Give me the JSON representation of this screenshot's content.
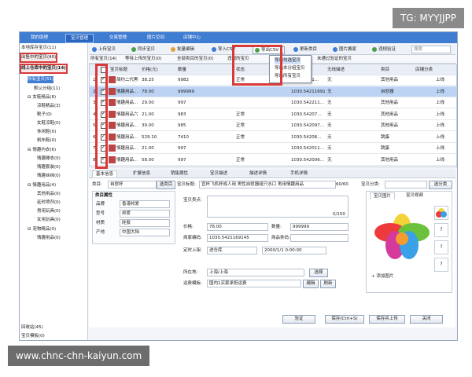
{
  "watermark": "TG: MYYJJPP",
  "footer_url": "www.chnc-chn-kaiyun.com",
  "colors": {
    "accent": "#3f7dd3",
    "highlight": "#d83a3a",
    "selected_row": "#bcd3f4"
  },
  "topnav": [
    "我的助理",
    "宝贝管理",
    "交易管理",
    "图片空间",
    "店铺中心"
  ],
  "sidebar": {
    "items": [
      "本地库存宝贝(11)",
      "出售中的宝贝(40)",
      "线上仓库中的宝贝(14)",
      "所有宝贝(51)",
      "默认分组(11)",
      "女鞋精品(8)",
      "凉鞋精品(3)",
      "靴子(0)",
      "女鞋凉鞋(0)",
      "休闲鞋(0)",
      "帆布鞋(0)",
      "情趣内衣(6)",
      "情趣睡衣(0)",
      "情趣套装(0)",
      "情趣丝袜(0)",
      "情趣用品(4)",
      "其他用品(0)",
      "延时喷剂(0)",
      "男用玩具(0)",
      "女用玩具(0)",
      "宠物精品(0)",
      "情趣用品(0)",
      "回收站(45)",
      "宝贝模板(0)"
    ]
  },
  "toolbar": {
    "items": [
      "上传宝贝",
      "同步宝贝",
      "批量编辑",
      "导入CSV",
      "导出CSV",
      "更新类目",
      "图片搬家",
      "违规验证"
    ],
    "search_placeholder": "搜索"
  },
  "export_menu": [
    "导出勾选宝贝",
    "导出本分组宝贝",
    "导出所有宝贝"
  ],
  "filters": [
    "所有宝贝(14)",
    "等待上传的宝贝(0)",
    "全部类目的宝贝(0)",
    "违规的宝贝",
    "未通过验证的宝贝"
  ],
  "grid": {
    "headers": [
      "宝贝标题",
      "价格(元)",
      "数量",
      "状态",
      "商家编码",
      "无线描述",
      "类目",
      "店铺分类"
    ],
    "rows": [
      {
        "num": "1",
        "title": "简约二代黑...",
        "price": "38.25",
        "qty": "9982",
        "status": "正常",
        "code": "1030.5421...",
        "mobile": "无",
        "category": "其他用品",
        "shop": "上线"
      },
      {
        "num": "2",
        "title": "情趣用品...",
        "price": "78.00",
        "qty": "999999",
        "status": "",
        "code": "1030.54211691...",
        "mobile": "无",
        "category": "自慰器",
        "shop": "上线"
      },
      {
        "num": "3",
        "title": "情趣用品...",
        "price": "29.00",
        "qty": "997",
        "status": "",
        "code": "1030.542211...",
        "mobile": "无",
        "category": "其他用品",
        "shop": "上线"
      },
      {
        "num": "4",
        "title": "情趣用品六...",
        "price": "21.00",
        "qty": "983",
        "status": "正常",
        "code": "1030.54207...",
        "mobile": "无",
        "category": "其他用品",
        "shop": "上线"
      },
      {
        "num": "5",
        "title": "情趣用品...",
        "price": "39.00",
        "qty": "985",
        "status": "正常",
        "code": "1030.542097...",
        "mobile": "无",
        "category": "其他用品",
        "shop": "上线"
      },
      {
        "num": "6",
        "title": "情趣用品...",
        "price": "529.10",
        "qty": "7410",
        "status": "正常",
        "code": "1030.54206...",
        "mobile": "无",
        "category": "跳蛋",
        "shop": "上线"
      },
      {
        "num": "7",
        "title": "情趣用品...",
        "price": "21.00",
        "qty": "997",
        "status": "",
        "code": "1030.542011...",
        "mobile": "无",
        "category": "跳蛋",
        "shop": "上线"
      },
      {
        "num": "8",
        "title": "情趣用品...",
        "price": "58.00",
        "qty": "997",
        "status": "正常",
        "code": "1030.542006...",
        "mobile": "无",
        "category": "其他用品",
        "shop": "上线"
      }
    ]
  },
  "detail_tabs": [
    "基本信息",
    "扩展信息",
    "销售属性",
    "宝贝描述",
    "描述详情",
    "手机详情"
  ],
  "form": {
    "category_label": "类目:",
    "category_value": "自慰杯",
    "choose_btn": "选类目",
    "title_label": "宝贝标题:",
    "title_value": "宜杯飞机杯成人用 男性自慰器组只水口 男用情趣用品",
    "title_count": "60/60",
    "shop_cat_label": "宝贝分类:",
    "shop_cat_btn": "选分类",
    "props_label": "类目属性",
    "props": [
      [
        "品牌",
        "香港邦爱"
      ],
      [
        "型号",
        "邦爱"
      ],
      [
        "材质",
        "硅胶"
      ],
      [
        "产地",
        "中国大陆"
      ]
    ],
    "selling_label": "宝贝卖点:",
    "selling_count": "0/150",
    "price_label": "价格:",
    "price_value": "78.00",
    "qty_label": "数量:",
    "qty_value": "999999",
    "code_label": "商家编码:",
    "code_value": "1030.5421169145",
    "barcode_label": "商品条码:",
    "time_label": "定时上架:",
    "time_value": "进仓库",
    "time_date": "2000/1/1 0:00:00",
    "location_label": "所在地:",
    "location_value": "上海/上海",
    "location_btn": "选择",
    "shipping_label": "运费模板:",
    "shipping_value": "国内1买家承担运费",
    "edit_btn": "编辑",
    "refresh_btn": "刷新",
    "image_tabs": [
      "宝贝图片",
      "宝贝视频"
    ],
    "add_image": "添加图片",
    "buttons": [
      "验证",
      "保存(Ctrl+S)",
      "保存并上传",
      "关闭"
    ]
  }
}
